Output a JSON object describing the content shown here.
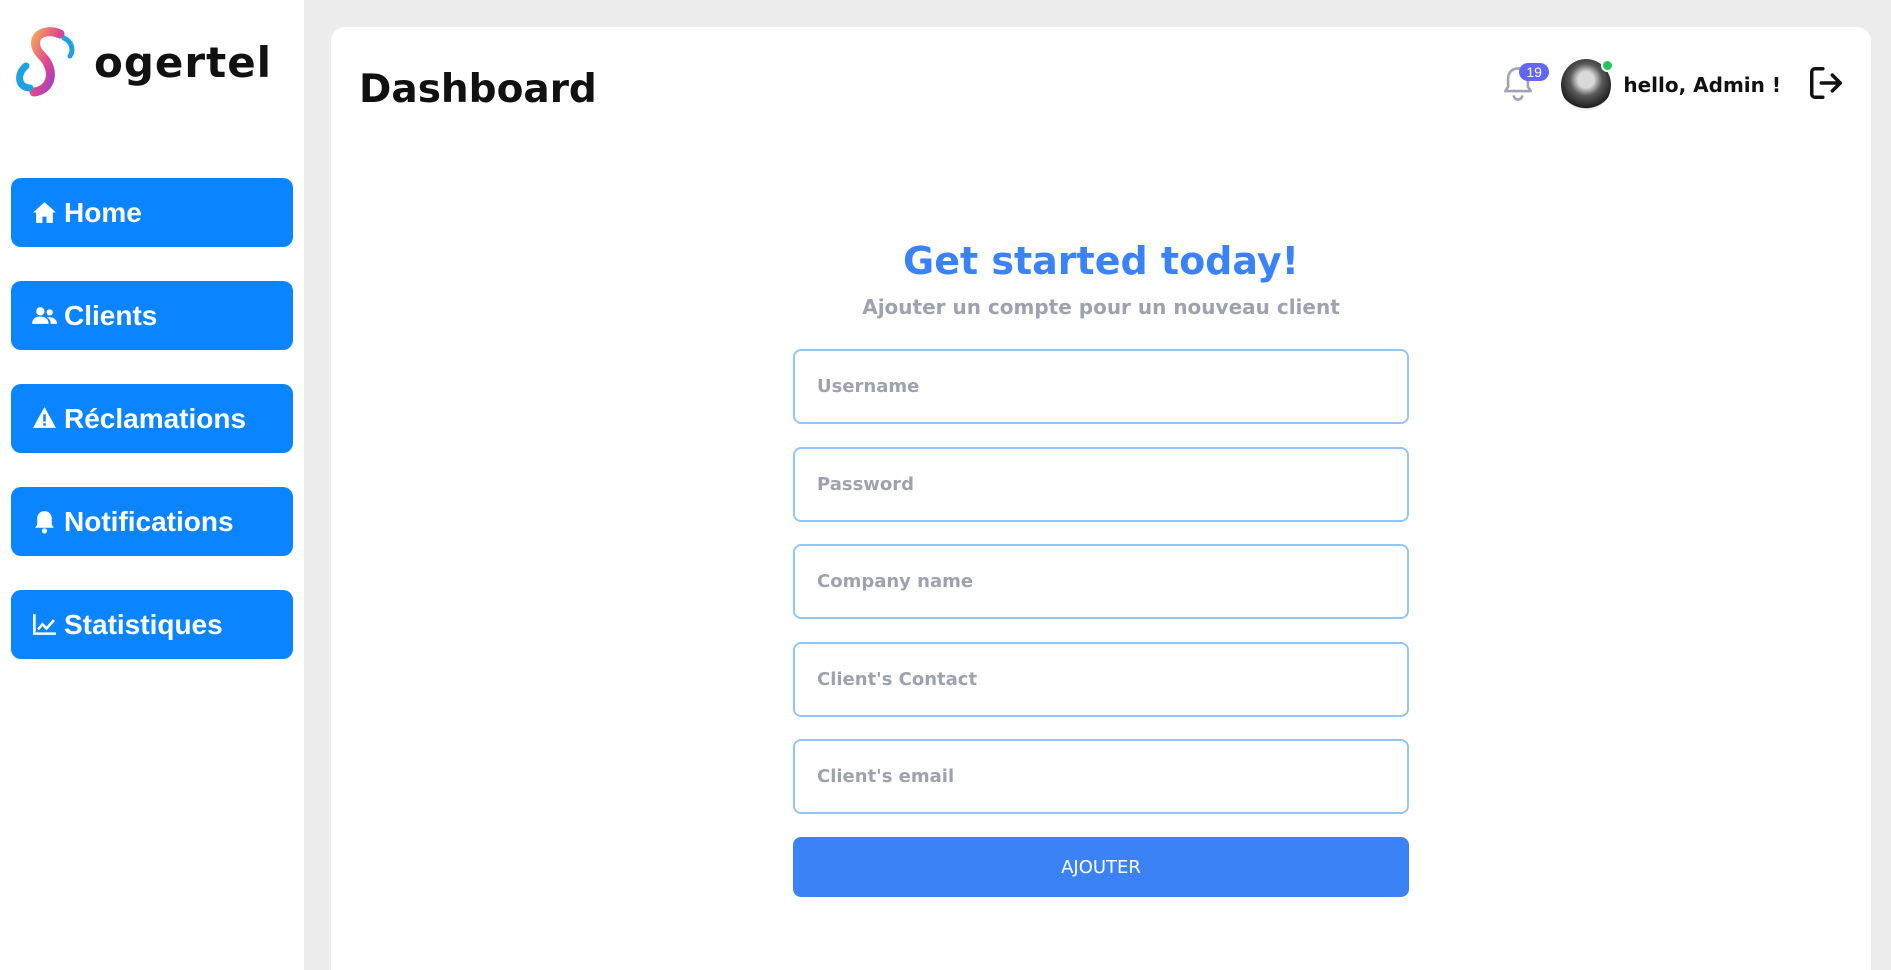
{
  "brand": {
    "name": "ogertel"
  },
  "sidebar": {
    "items": [
      {
        "label": "Home",
        "icon": "home-icon"
      },
      {
        "label": "Clients",
        "icon": "users-icon"
      },
      {
        "label": "Réclamations",
        "icon": "warning-icon"
      },
      {
        "label": "Notifications",
        "icon": "bell-icon"
      },
      {
        "label": "Statistiques",
        "icon": "chart-line-icon"
      }
    ]
  },
  "header": {
    "title": "Dashboard",
    "notification_count": "19",
    "greeting": "hello, Admin !"
  },
  "form": {
    "title": "Get started today!",
    "subtitle": "Ajouter un compte pour un nouveau client",
    "fields": [
      {
        "placeholder": "Username",
        "value": ""
      },
      {
        "placeholder": "Password",
        "value": ""
      },
      {
        "placeholder": "Company name",
        "value": ""
      },
      {
        "placeholder": "Client's Contact",
        "value": ""
      },
      {
        "placeholder": "Client's email",
        "value": ""
      }
    ],
    "submit_label": "AJOUTER"
  },
  "colors": {
    "nav_blue": "#0a84ff",
    "accent_blue": "#3b82f6",
    "input_border": "#93c5fd",
    "badge": "#6366f1",
    "online": "#22c55e"
  }
}
